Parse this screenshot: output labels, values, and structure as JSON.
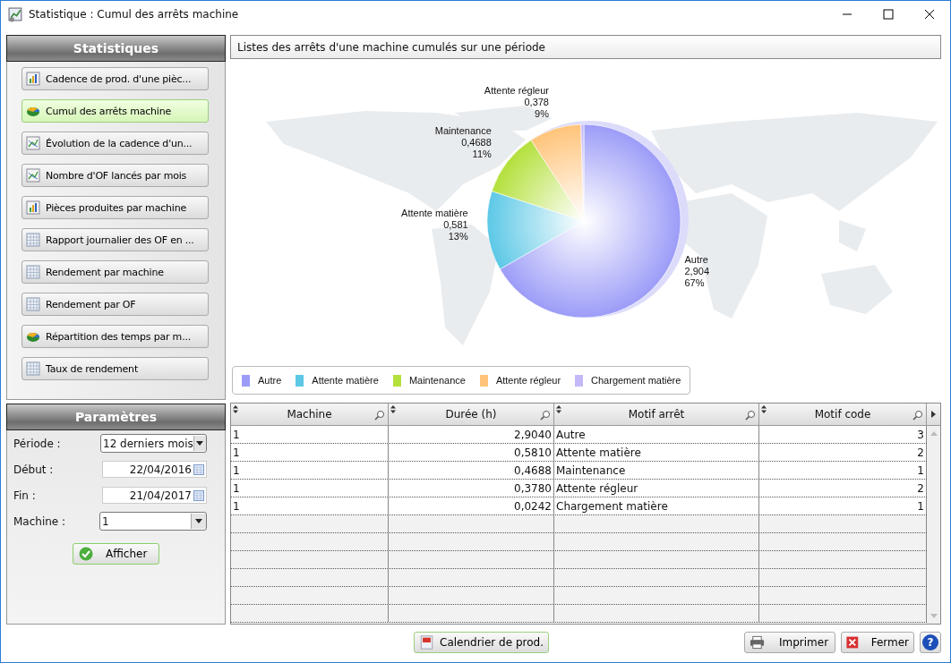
{
  "window": {
    "title": "Statistique : Cumul des arrêts machine"
  },
  "statistics_panel": {
    "title": "Statistiques",
    "items": [
      {
        "label": "Cadence de prod. d'une pièc...",
        "kind": "bar",
        "selected": false
      },
      {
        "label": "Cumul des arrêts machine",
        "kind": "pie",
        "selected": true
      },
      {
        "label": "Évolution de la cadence d'un...",
        "kind": "line",
        "selected": false
      },
      {
        "label": "Nombre d'OF lancés par mois",
        "kind": "line",
        "selected": false
      },
      {
        "label": "Pièces produites par machine",
        "kind": "bar",
        "selected": false
      },
      {
        "label": "Rapport journalier des OF en ...",
        "kind": "grid",
        "selected": false
      },
      {
        "label": "Rendement par machine",
        "kind": "grid",
        "selected": false
      },
      {
        "label": "Rendement par OF",
        "kind": "grid",
        "selected": false
      },
      {
        "label": "Répartition des temps par m...",
        "kind": "pie",
        "selected": false
      },
      {
        "label": "Taux de rendement",
        "kind": "grid",
        "selected": false
      }
    ]
  },
  "parameters_panel": {
    "title": "Paramètres",
    "fields": [
      {
        "label": "Période :",
        "value": "12 derniers mois",
        "kind": "select"
      },
      {
        "label": "Début :",
        "value": "22/04/2016",
        "kind": "date"
      },
      {
        "label": "Fin :",
        "value": "21/04/2017",
        "kind": "date"
      },
      {
        "label": "Machine :",
        "value": "1",
        "kind": "select"
      }
    ],
    "button": "Afficher"
  },
  "report": {
    "title": "Listes des arrêts d'une machine cumulés sur une période",
    "slice_labels": [
      {
        "name": "Attente régleur",
        "value": "0,378",
        "percent": "9%"
      },
      {
        "name": "Maintenance",
        "value": "0,4688",
        "percent": "11%"
      },
      {
        "name": "Attente matière",
        "value": "0,581",
        "percent": "13%"
      },
      {
        "name": "Autre",
        "value": "2,904",
        "percent": "67%"
      }
    ],
    "legend": [
      {
        "color": "#9c9cf8"
      },
      {
        "color": "#5cc8e6"
      },
      {
        "color": "#b4e03c"
      },
      {
        "color": "#ffc47a"
      },
      {
        "color": "#c4b8f8"
      }
    ],
    "chart_data": {
      "type": "pie",
      "categories": [
        "Autre",
        "Attente matière",
        "Maintenance",
        "Attente régleur",
        "Chargement matière"
      ],
      "values": [
        66.7,
        13.3,
        10.8,
        8.7,
        0.5
      ]
    }
  },
  "table": {
    "columns": [
      "Machine",
      "Durée (h)",
      "Motif arrêt",
      "Motif code"
    ],
    "rows": [
      [
        "1",
        "2,9040",
        "Autre",
        "3"
      ],
      [
        "1",
        "0,5810",
        "Attente matière",
        "2"
      ],
      [
        "1",
        "0,4688",
        "Maintenance",
        "1"
      ],
      [
        "1",
        "0,3780",
        "Attente régleur",
        "2"
      ],
      [
        "1",
        "0,0242",
        "Chargement matière",
        "1"
      ]
    ]
  },
  "footer": {
    "calendar_button": "Calendrier de prod.",
    "print_button": "Imprimer",
    "close_button": "Fermer",
    "help_button": "?"
  }
}
